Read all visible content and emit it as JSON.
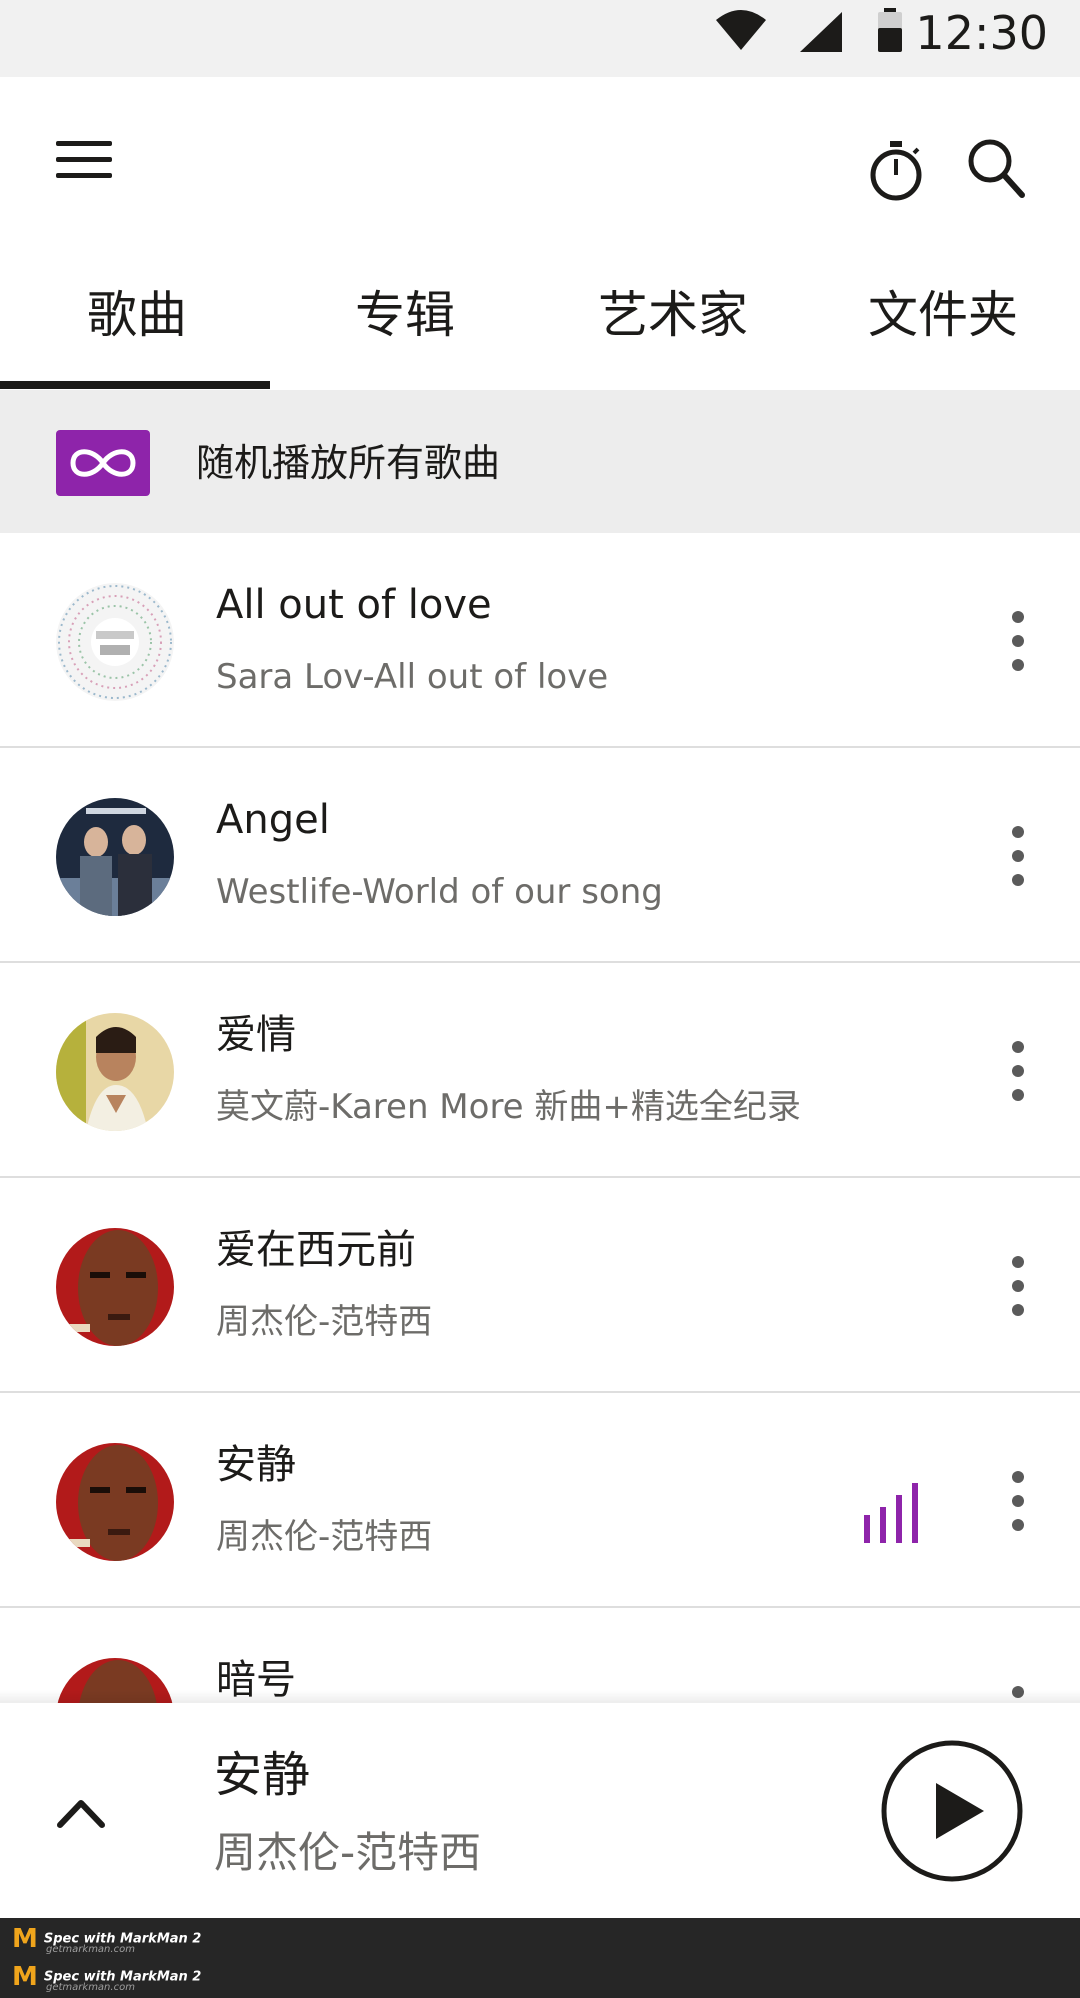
{
  "status_bar": {
    "time": "12:30",
    "wifi_icon": "wifi-icon",
    "signal_icon": "cell-signal-icon",
    "battery_icon": "battery-icon"
  },
  "app_bar": {
    "menu_icon": "hamburger-menu-icon",
    "timer_icon": "sleep-timer-icon",
    "search_icon": "search-icon"
  },
  "tabs": [
    {
      "label": "歌曲",
      "selected": true
    },
    {
      "label": "专辑",
      "selected": false
    },
    {
      "label": "艺术家",
      "selected": false
    },
    {
      "label": "文件夹",
      "selected": false
    }
  ],
  "shuffle": {
    "label": "随机播放所有歌曲",
    "icon": "shuffle-infinity-icon",
    "icon_color": "#8e24aa"
  },
  "songs": [
    {
      "title": "All out of love",
      "subtitle": "Sara Lov-All out of love",
      "playing": false
    },
    {
      "title": "Angel",
      "subtitle": "Westlife-World of our song",
      "playing": false
    },
    {
      "title": "爱情",
      "subtitle": "莫文蔚-Karen More 新曲+精选全纪录",
      "playing": false
    },
    {
      "title": "爱在西元前",
      "subtitle": "周杰伦-范特西",
      "playing": false
    },
    {
      "title": "安静",
      "subtitle": "周杰伦-范特西",
      "playing": true
    },
    {
      "title": "暗号",
      "subtitle": "",
      "playing": false
    }
  ],
  "now_playing": {
    "title": "安静",
    "subtitle": "周杰伦-范特西",
    "collapse_icon": "chevron-up-icon",
    "play_icon": "play-icon"
  },
  "footer": {
    "brand_line_1": "Spec with MarkMan 2",
    "brand_url_1": "getmarkman.com",
    "brand_line_2": "Spec with MarkMan 2",
    "brand_url_2": "getmarkman.com"
  },
  "colors": {
    "primary_text": "#1c1b19",
    "secondary_text": "#6d6c69",
    "accent": "#8e24aa"
  }
}
